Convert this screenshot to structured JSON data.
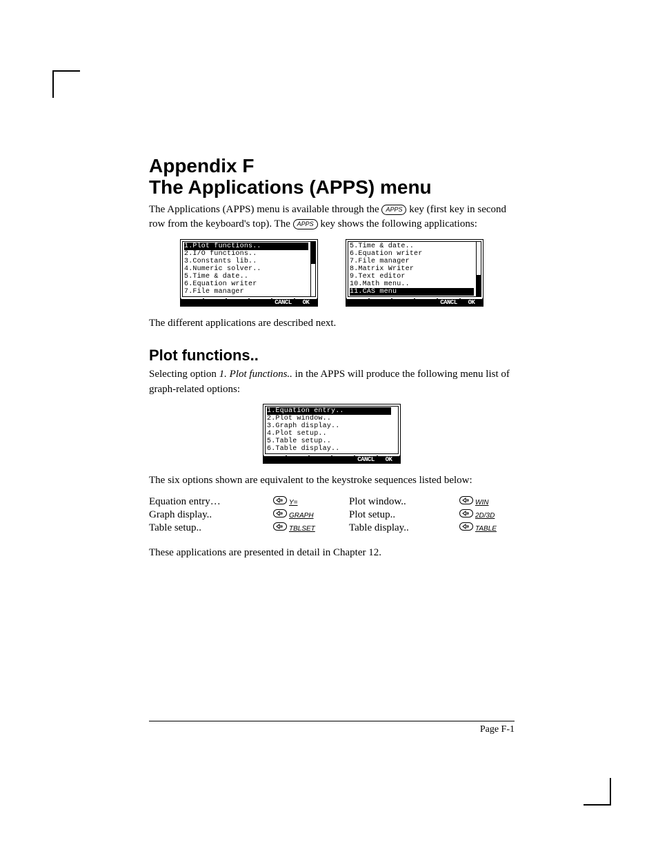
{
  "heading_line1": "Appendix F",
  "heading_line2": "The Applications (APPS) menu",
  "intro_part1": "The Applications (APPS) menu is available through the ",
  "intro_key": "APPS",
  "intro_part2": " key (first key in second row from the keyboard's top).   The ",
  "intro_part3": " key shows the following applications:",
  "apps_screen_left": {
    "items": [
      "1.Plot functions..",
      "2.I/O functions..",
      "3.Constants lib..",
      "4.Numeric solver..",
      "5.Time & date..",
      "6.Equation writer",
      "7.File manager"
    ],
    "selected": 0,
    "scroll_thumb": "top",
    "softkeys": [
      "",
      "",
      "",
      "",
      "CANCL",
      "OK"
    ]
  },
  "apps_screen_right": {
    "items": [
      "5.Time & date..",
      "6.Equation writer",
      "7.File manager",
      "8.Matrix Writer",
      "9.Text editor",
      "10.Math menu..",
      "11.CAS menu"
    ],
    "selected": 6,
    "scroll_thumb": "bottom",
    "softkeys": [
      "",
      "",
      "",
      "",
      "CANCL",
      "OK"
    ]
  },
  "after_shots": "The different applications are described next.",
  "section2_heading": "Plot functions..",
  "section2_para_a": "Selecting option ",
  "section2_para_ital": "1. Plot functions..",
  "section2_para_b": " in the APPS will produce the following menu list of graph-related options:",
  "plot_screen": {
    "items": [
      "1.Equation entry..",
      "2.Plot window..",
      "3.Graph display..",
      "4.Plot setup..",
      "5.Table setup..",
      "6.Table display.."
    ],
    "selected": 0,
    "scroll_thumb": "none",
    "softkeys": [
      "",
      "",
      "",
      "",
      "CANCL",
      "OK"
    ]
  },
  "equiv_text": "The six options shown are equivalent to the keystroke sequences listed below:",
  "kv_rows": [
    {
      "l1": "Equation entry…",
      "k1": "Y=",
      "l2": "Plot window..",
      "k2": "WIN"
    },
    {
      "l1": "Graph display..",
      "k1": "GRAPH",
      "l2": "Plot setup..",
      "k2": "2D/3D"
    },
    {
      "l1": "Table setup..",
      "k1": "TBLSET",
      "l2": "Table display..",
      "k2": "TABLE"
    }
  ],
  "closing": "These applications are presented in detail in Chapter 12.",
  "footer": "Page F-1"
}
